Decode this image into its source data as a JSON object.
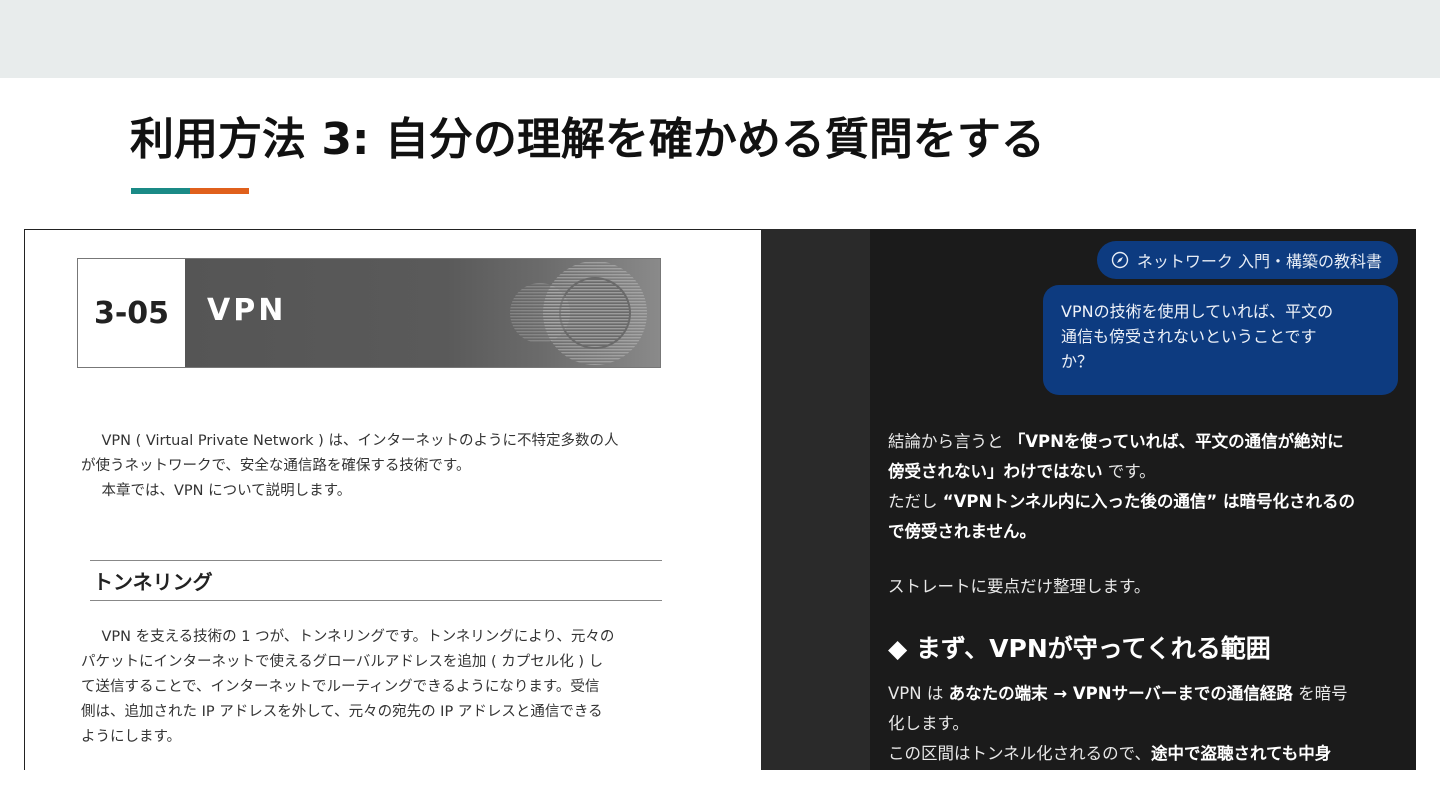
{
  "slide": {
    "title": "利用方法 3: 自分の理解を確かめる質問をする",
    "accent_colors": {
      "teal": "#1a8a86",
      "orange": "#e0601c"
    }
  },
  "book": {
    "chapter_number": "3-05",
    "chapter_title": "VPN",
    "intro_lines": [
      "　VPN ( Virtual Private Network ) は、インターネットのように不特定多数の人",
      "が使うネットワークで、安全な通信路を確保する技術です。",
      "　本章では、VPN について説明します。"
    ],
    "section_heading": "トンネリング",
    "section_lines": [
      "　VPN を支える技術の 1 つが、トンネリングです。トンネリングにより、元々の",
      "パケットにインターネットで使えるグローバルアドレスを追加 ( カプセル化 ) し",
      "て送信することで、インターネットでルーティングできるようになります。受信",
      "側は、追加された IP アドレスを外して、元々の宛先の IP アドレスと通信できる",
      "ようにします。"
    ]
  },
  "chat": {
    "source_chip": "ネットワーク 入門・構築の教科書",
    "source_icon": "compass-icon",
    "user_message_lines": [
      "VPNの技術を使用していれば、平文の",
      "通信も傍受されないということです",
      "か？"
    ],
    "reply": {
      "line1_a": "結論から言うと ",
      "line1_b": "「VPNを使っていれば、平文の通信が絶対に",
      "line2_b": "傍受されない」わけではない",
      "line2_c": " です。",
      "line3_a": "ただし ",
      "line3_b": "“VPNトンネル内に入った後の通信” は暗号化されるの",
      "line4_b": "で傍受されません。",
      "summary": "ストレートに要点だけ整理します。",
      "heading": "◆ まず、VPNが守ってくれる範囲",
      "line5_a": "VPN は ",
      "line5_b": "あなたの端末 → VPNサーバーまでの通信経路",
      "line5_c": " を暗号",
      "line6_a": "化します。",
      "line7_a": "この区間はトンネル化されるので、",
      "line7_b": "途中で盗聴されても中身"
    }
  }
}
